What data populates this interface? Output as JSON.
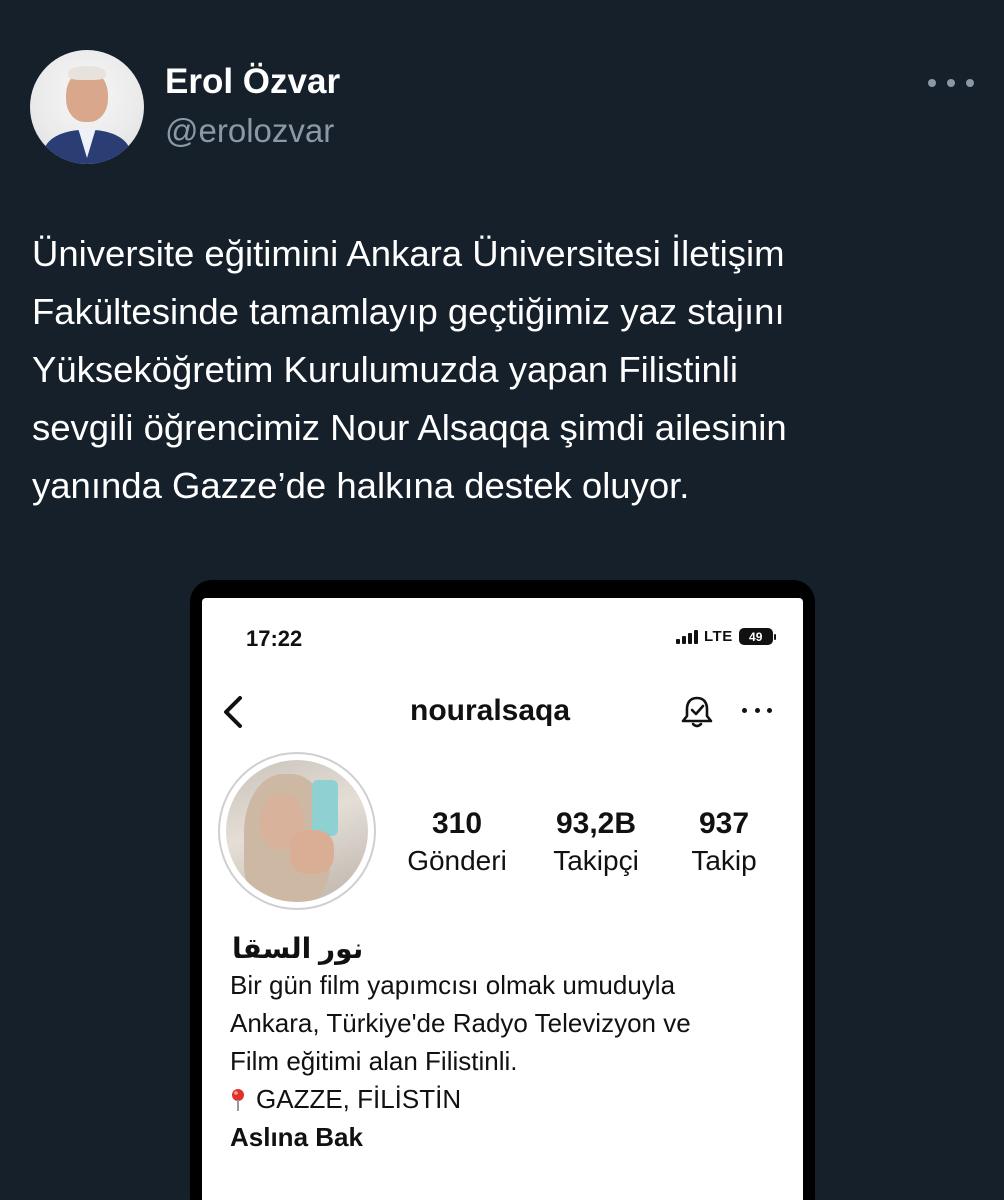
{
  "tweet": {
    "display_name": "Erol Özvar",
    "handle": "@erolozvar",
    "text_lines": [
      "Üniversite eğitimini Ankara Üniversitesi İletişim",
      "Fakültesinde tamamlayıp geçtiğimiz yaz stajını",
      "Yükseköğretim Kurulumuzda yapan Filistinli",
      "sevgili öğrencimiz Nour Alsaqqa şimdi ailesinin",
      "yanında Gazze’de halkına destek oluyor."
    ]
  },
  "embedded_screenshot": {
    "status_bar": {
      "time": "17:22",
      "network": "LTE",
      "battery": "49"
    },
    "profile": {
      "username": "nouralsaqa",
      "stats": [
        {
          "value": "310",
          "label": "Gönderi"
        },
        {
          "value": "93,2B",
          "label": "Takipçi"
        },
        {
          "value": "937",
          "label": "Takip"
        }
      ],
      "name": "نور السقا",
      "bio_lines": [
        "Bir gün film yapımcısı olmak umuduyla",
        "Ankara, Türkiye'de Radyo Televizyon ve",
        "Film eğitimi alan Filistinli."
      ],
      "location": "GAZZE, FİLİSTİN",
      "link_text": "Aslına Bak"
    }
  },
  "icons": {
    "more": "more-horizontal-icon",
    "back": "chevron-left-icon",
    "bell": "notification-bell-icon",
    "options": "more-horizontal-icon",
    "pin": "location-pin-icon"
  },
  "colors": {
    "background": "#15202b",
    "primary_text": "#ffffff",
    "secondary_text": "#8b98a5",
    "pin_red": "#e0312a"
  }
}
